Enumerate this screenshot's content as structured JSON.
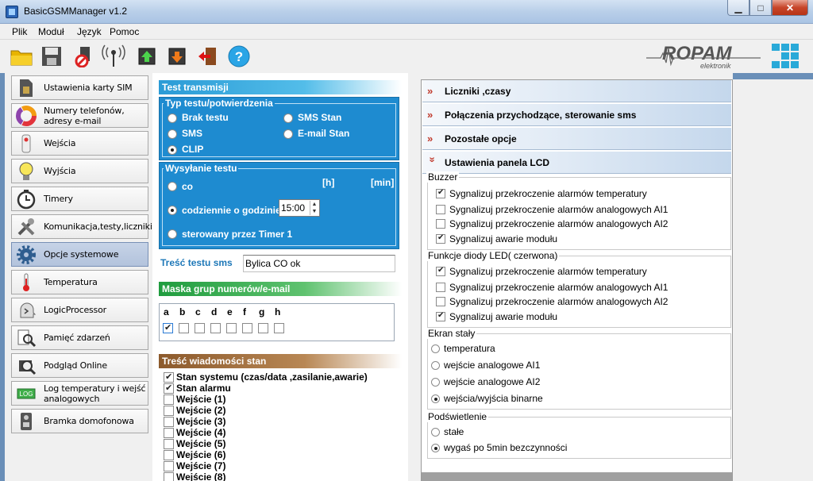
{
  "window": {
    "title": "BasicGSMManager v1.2"
  },
  "menu": [
    {
      "label": "Plik"
    },
    {
      "label": "Moduł"
    },
    {
      "label": "Język"
    },
    {
      "label": "Pomoc"
    }
  ],
  "toolbar": {
    "icons": [
      "folder-open-icon",
      "save-icon",
      "no-write-icon",
      "antenna-icon",
      "upload-chip-icon",
      "download-chip-icon",
      "exit-door-icon",
      "help-icon"
    ],
    "logo_text": "ROPAM",
    "logo_sub": "elektronik"
  },
  "nav": [
    {
      "label": "Ustawienia karty SIM",
      "icon": "sim-card-icon"
    },
    {
      "label": "Numery telefonów, adresy e-mail",
      "icon": "contacts-ring-icon"
    },
    {
      "label": "Wejścia",
      "icon": "sensor-icon"
    },
    {
      "label": "Wyjścia",
      "icon": "bulb-icon"
    },
    {
      "label": "Timery",
      "icon": "clock-icon"
    },
    {
      "label": "Komunikacja,testy,liczniki",
      "icon": "tools-icon"
    },
    {
      "label": "Opcje systemowe",
      "icon": "gear-icon",
      "active": true
    },
    {
      "label": "Temperatura",
      "icon": "thermometer-icon"
    },
    {
      "label": "LogicProcessor",
      "icon": "logic-head-icon"
    },
    {
      "label": "Pamięć zdarzeń",
      "icon": "event-memory-icon"
    },
    {
      "label": "Podgląd Online",
      "icon": "online-preview-icon"
    },
    {
      "label": "Log temperatury i wejść analogowych",
      "icon": "log-icon"
    },
    {
      "label": "Bramka domofonowa",
      "icon": "intercom-icon"
    }
  ],
  "test": {
    "section_title": "Test transmisji",
    "type_legend": "Typ testu/potwierdzenia",
    "types": [
      {
        "label": "Brak testu",
        "checked": false
      },
      {
        "label": "SMS Stan",
        "checked": false
      },
      {
        "label": "SMS",
        "checked": false
      },
      {
        "label": "E-mail Stan",
        "checked": false
      },
      {
        "label": "CLIP",
        "checked": true
      }
    ],
    "send_legend": "Wysyłanie testu",
    "unit_h": "[h]",
    "unit_min": "[min]",
    "send_options": [
      {
        "label": "co",
        "checked": false
      },
      {
        "label": "codziennie o godzinie",
        "checked": true
      },
      {
        "label": "sterowany przez Timer 1",
        "checked": false
      }
    ],
    "time_value": "15:00",
    "sms_label": "Treść testu sms",
    "sms_value": "Bylica CO ok"
  },
  "mask": {
    "title": "Maska grup numerów/e-mail",
    "letters": [
      "a",
      "b",
      "c",
      "d",
      "e",
      "f",
      "g",
      "h"
    ],
    "checked": [
      true,
      false,
      false,
      false,
      false,
      false,
      false,
      false
    ]
  },
  "status_msg": {
    "title": "Treść wiadomości stan",
    "items": [
      {
        "label": "Stan systemu (czas/data ,zasilanie,awarie)",
        "checked": true
      },
      {
        "label": "Stan alarmu",
        "checked": true
      },
      {
        "label": "Wejście (1)",
        "checked": false
      },
      {
        "label": "Wejście (2)",
        "checked": false
      },
      {
        "label": "Wejście (3)",
        "checked": false
      },
      {
        "label": "Wejście (4)",
        "checked": false
      },
      {
        "label": "Wejście (5)",
        "checked": false
      },
      {
        "label": "Wejście (6)",
        "checked": false
      },
      {
        "label": "Wejście (7)",
        "checked": false
      },
      {
        "label": "Wejście (8)",
        "checked": false
      }
    ]
  },
  "accordion": [
    {
      "label": "Liczniki ,czasy",
      "expanded": false
    },
    {
      "label": "Połączenia przychodzące, sterowanie sms",
      "expanded": false
    },
    {
      "label": "Pozostałe opcje",
      "expanded": false
    },
    {
      "label": "Ustawienia panela LCD",
      "expanded": true
    }
  ],
  "lcd": {
    "buzzer": {
      "title": "Buzzer",
      "items": [
        {
          "label": "Sygnalizuj przekroczenie alarmów temperatury",
          "checked": true
        },
        {
          "label": "Sygnalizuj przekroczenie alarmów analogowych AI1",
          "checked": false
        },
        {
          "label": "Sygnalizuj przekroczenie alarmów analogowych AI2",
          "checked": false
        },
        {
          "label": "Sygnalizuj awarie modułu",
          "checked": true
        }
      ]
    },
    "led": {
      "title": "Funkcje diody LED( czerwona)",
      "items": [
        {
          "label": "Sygnalizuj przekroczenie alarmów temperatury",
          "checked": true
        },
        {
          "label": "Sygnalizuj przekroczenie alarmów analogowych AI1",
          "checked": false
        },
        {
          "label": "Sygnalizuj przekroczenie alarmów analogowych AI2",
          "checked": false
        },
        {
          "label": "Sygnalizuj awarie modułu",
          "checked": true
        }
      ]
    },
    "screen": {
      "title": "Ekran stały",
      "items": [
        {
          "label": "temperatura",
          "checked": false
        },
        {
          "label": "wejście analogowe AI1",
          "checked": false
        },
        {
          "label": "wejście analogowe AI2",
          "checked": false
        },
        {
          "label": "wejścia/wyjścia binarne",
          "checked": true
        }
      ]
    },
    "backlight": {
      "title": "Podświetlenie",
      "items": [
        {
          "label": "stałe",
          "checked": false
        },
        {
          "label": "wygaś po 5min bezczynności",
          "checked": true
        }
      ]
    }
  }
}
